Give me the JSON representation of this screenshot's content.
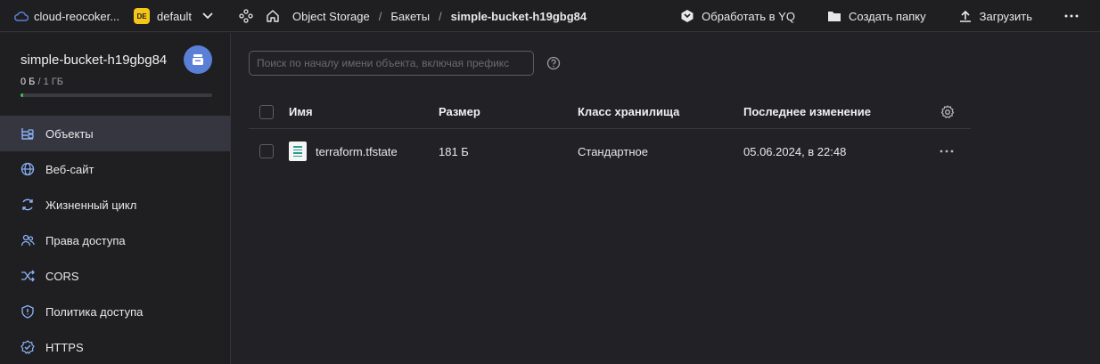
{
  "topbar": {
    "cloud": "cloud-reocoker...",
    "folder_badge": "DE",
    "folder": "default",
    "breadcrumbs": [
      "Object Storage",
      "Бакеты",
      "simple-bucket-h19gbg84"
    ],
    "actions": {
      "yq": "Обработать в YQ",
      "create_folder": "Создать папку",
      "upload": "Загрузить"
    }
  },
  "sidebar": {
    "bucket_name": "simple-bucket-h19gbg84",
    "usage_used": "0 Б",
    "usage_total": "/ 1 ГБ",
    "usage_fraction": 0.0,
    "items": [
      {
        "label": "Объекты",
        "icon": "objects-icon",
        "active": true
      },
      {
        "label": "Веб-сайт",
        "icon": "globe-icon"
      },
      {
        "label": "Жизненный цикл",
        "icon": "lifecycle-icon"
      },
      {
        "label": "Права доступа",
        "icon": "users-icon"
      },
      {
        "label": "CORS",
        "icon": "cors-icon"
      },
      {
        "label": "Политика доступа",
        "icon": "shield-icon"
      },
      {
        "label": "HTTPS",
        "icon": "https-icon"
      }
    ]
  },
  "main": {
    "search_placeholder": "Поиск по началу имени объекта, включая префикс",
    "columns": {
      "name": "Имя",
      "size": "Размер",
      "class": "Класс хранилища",
      "modified": "Последнее изменение"
    },
    "rows": [
      {
        "name": "terraform.tfstate",
        "size": "181 Б",
        "class": "Стандартное",
        "modified": "05.06.2024, в 22:48"
      }
    ]
  },
  "colors": {
    "background": "#222226",
    "panel": "#1f1f22",
    "accent": "#5a7fd6",
    "active_nav": "#363640",
    "usage_fill": "#3fb950"
  }
}
